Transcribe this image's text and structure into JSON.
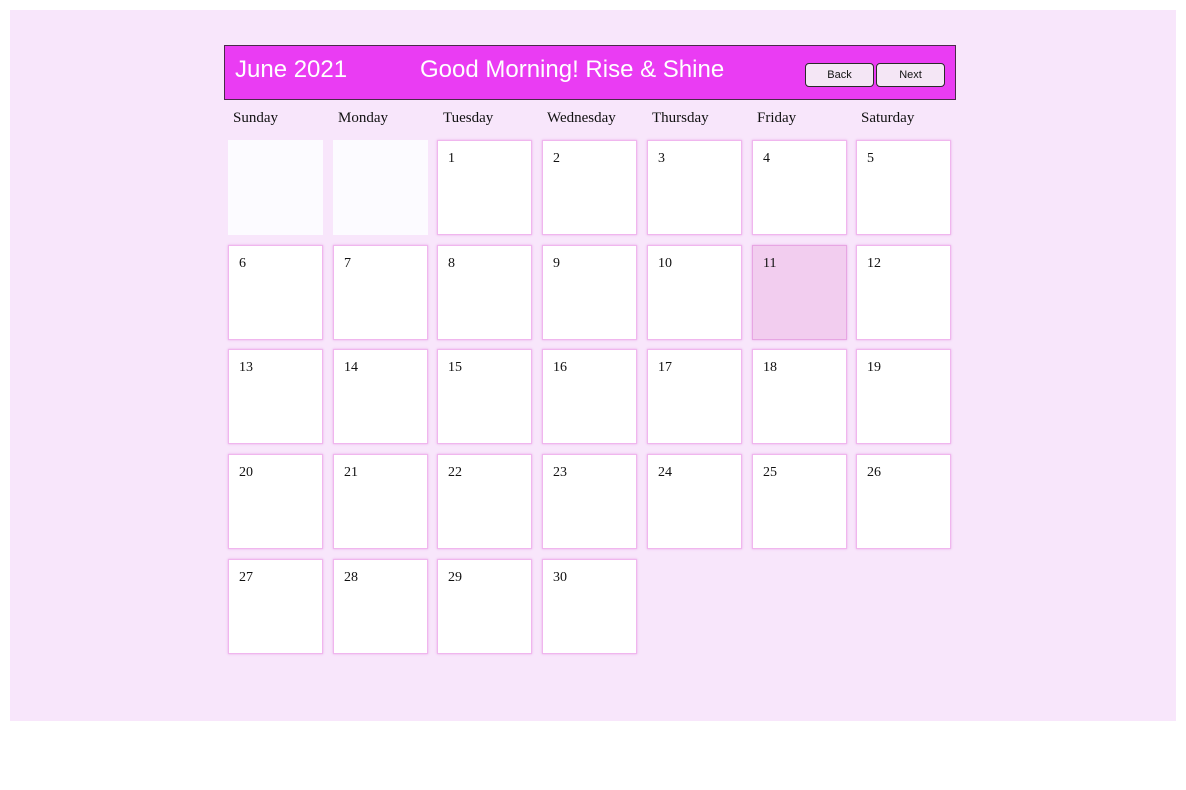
{
  "header": {
    "month_title": "June 2021",
    "greeting": "Good Morning! Rise & Shine",
    "back_label": "Back",
    "next_label": "Next"
  },
  "weekdays": [
    "Sunday",
    "Monday",
    "Tuesday",
    "Wednesday",
    "Thursday",
    "Friday",
    "Saturday"
  ],
  "calendar": {
    "leading_empty_days": 2,
    "days_in_month": 30,
    "highlighted_day": "11",
    "days": [
      "1",
      "2",
      "3",
      "4",
      "5",
      "6",
      "7",
      "8",
      "9",
      "10",
      "11",
      "12",
      "13",
      "14",
      "15",
      "16",
      "17",
      "18",
      "19",
      "20",
      "21",
      "22",
      "23",
      "24",
      "25",
      "26",
      "27",
      "28",
      "29",
      "30"
    ]
  },
  "colors": {
    "background": "#f8e6fb",
    "header": "#ea3cf3",
    "today": "#f2cdef",
    "cell_border": "#f0b6ee"
  }
}
